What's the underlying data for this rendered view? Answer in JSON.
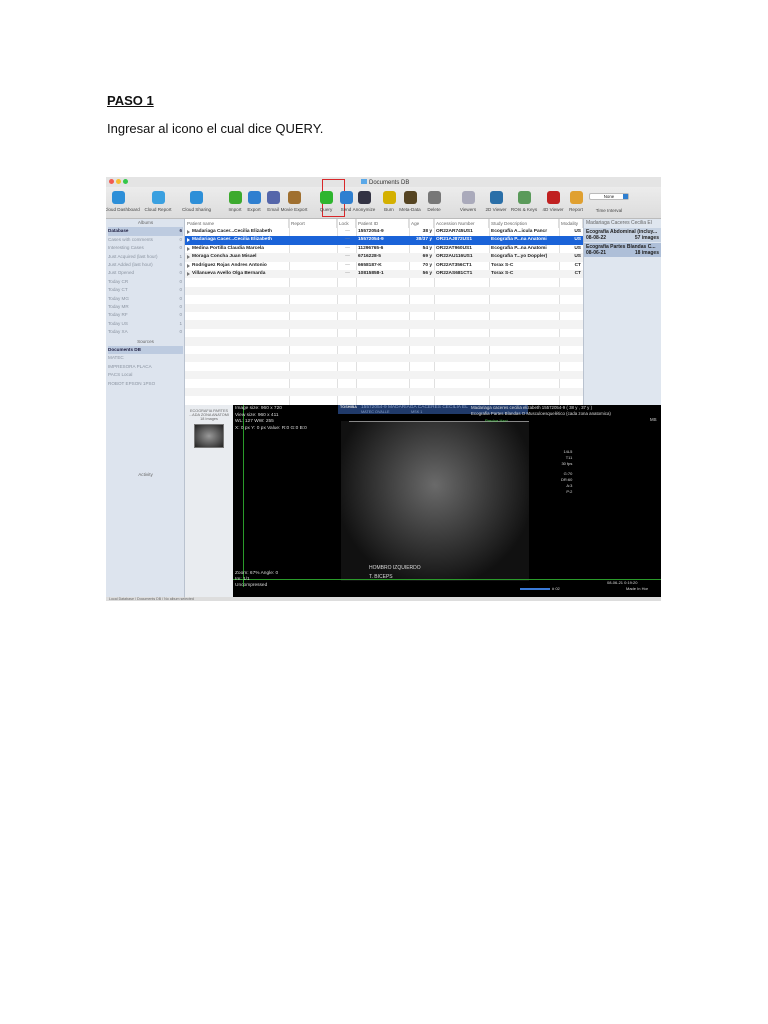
{
  "document": {
    "heading": "PASO 1",
    "instruction": "Ingresar al icono el cual dice QUERY."
  },
  "window": {
    "title": "Documents DB"
  },
  "toolbar": [
    {
      "label": "Cloud Dashboard",
      "color": "#2d8fd8"
    },
    {
      "label": "Cloud Report",
      "color": "#3aa0e0"
    },
    {
      "label": "Cloud Sharing",
      "color": "#2d8fd8"
    },
    {
      "label": "Import",
      "color": "#3caa2e"
    },
    {
      "label": "Export",
      "color": "#2f7fd0"
    },
    {
      "label": "Email",
      "color": "#5566aa"
    },
    {
      "label": "Movie Export",
      "color": "#a07030"
    },
    {
      "label": "Query",
      "color": "#2eb52e"
    },
    {
      "label": "Send",
      "color": "#2f7fd0"
    },
    {
      "label": "Anonymize",
      "color": "#334"
    },
    {
      "label": "Burn",
      "color": "#d4b000"
    },
    {
      "label": "Meta-Data",
      "color": "#554422"
    },
    {
      "label": "Delete",
      "color": "#777"
    },
    {
      "label": "Viewers",
      "color": "#aab"
    },
    {
      "label": "2D Viewer",
      "color": "#2a6fa8"
    },
    {
      "label": "ROIs & Keys",
      "color": "#5a9a5a"
    },
    {
      "label": "4D Viewer",
      "color": "#c02020"
    },
    {
      "label": "Report",
      "color": "#e0a030"
    }
  ],
  "time_interval": {
    "value": "None",
    "label": "Time Interval"
  },
  "sidebar": {
    "albums_header": "Albums",
    "albums": [
      {
        "label": "Database",
        "count": "6"
      },
      {
        "label": "Cases with comments",
        "count": "0"
      },
      {
        "label": "Interesting Cases",
        "count": "0"
      },
      {
        "label": "Just Acquired (last hour)",
        "count": "1"
      },
      {
        "label": "Just Added (last hour)",
        "count": "6"
      },
      {
        "label": "Just Opened",
        "count": "0"
      },
      {
        "label": "Today CR",
        "count": "0"
      },
      {
        "label": "Today CT",
        "count": "0"
      },
      {
        "label": "Today MG",
        "count": "0"
      },
      {
        "label": "Today MR",
        "count": "0"
      },
      {
        "label": "Today RF",
        "count": "0"
      },
      {
        "label": "Today US",
        "count": "1"
      },
      {
        "label": "Today XA",
        "count": "0"
      }
    ],
    "sources_header": "Sources",
    "sources": [
      "Documents DB",
      "MATEC",
      "IMPRESORA PLACA",
      "PACS Local",
      "ROBOT EPSON 1PSO"
    ],
    "activity": "Activity"
  },
  "table": {
    "columns": [
      "Patient name",
      "Report",
      "Lock",
      "Patient ID",
      "Age",
      "Accession Number",
      "Study Description",
      "Modality"
    ],
    "rows": [
      [
        "Madariaga Cacer...Cecilia Elizabeth",
        "",
        "—",
        "15572054-9",
        "38 y",
        "OR22AR745US1",
        "Ecografía A...icula Pancr",
        "US"
      ],
      [
        "Madariaga Cacer...Cecilia Elizabeth",
        "",
        "—",
        "15572054-9",
        "38/37 y",
        "OR21AJ872US1",
        "Ecografía P...na Anatomi",
        "US"
      ],
      [
        "Medina Portilla Claudia Marcela",
        "",
        "—",
        "11296765-6",
        "54 y",
        "OR22AT960US1",
        "Ecografía P...na Anatomi",
        "US"
      ],
      [
        "Moraga Concha Juan Misael",
        "",
        "—",
        "6716228-5",
        "69 y",
        "OR22AU116US1",
        "Ecografía T...yo Doppler)",
        "US"
      ],
      [
        "Rodriguez Rojas Andres Antonio",
        "",
        "—",
        "6658187-K",
        "70 y",
        "OR22AT356CT1",
        "Torax S-C",
        "CT"
      ],
      [
        "Villanueva Avello Olga Bernarda",
        "",
        "—",
        "10815858-1",
        "56 y",
        "OR22AS681CT1",
        "Torax S-C",
        "CT"
      ]
    ]
  },
  "right_panel": {
    "header": "Madariaga Caceres Cecilia El",
    "studies": [
      {
        "name": "Ecografía Abdominal (incluy...",
        "date": "08-08-22",
        "images": "57 images"
      },
      {
        "name": "Ecografía Partes Blandas C...",
        "date": "08-06-21",
        "images": "18 images"
      }
    ]
  },
  "thumbnail": {
    "title": "ECOGRAFIA PARTES ...ADA ZONA ANATOMI",
    "count": "18 Images"
  },
  "viewer": {
    "info": [
      "Image size: 960 x 720",
      "View size: 960 x 411",
      "WL: 127 WW: 255",
      "X: 0 px Y: 0 px Value: R:0 G:0 B:0"
    ],
    "bottom_left": [
      "Zoom: 67% Angle: 0",
      "Im: 1/1",
      "Uncompressed"
    ],
    "header_patient": "15572054-9 MADARIAGA CACERES CECILIA EL",
    "header_brand": "TOSHIBA",
    "header_site": "MATEC OVALLE",
    "header_ref": "MSK 1",
    "top_right_1": "Madariaga caceres cecilia elizabeth 15572054-9 ( 38 y , 37 y )",
    "top_right_2": "Ecografia Partes Blandas O Musculoesquelético (cada zona anatomica)",
    "top_right_3": "MS",
    "probe": "Precise  Har+",
    "params": [
      "14L5",
      "T11",
      "30 fps",
      "G:70",
      "DR:60",
      "A:3",
      "P:2"
    ],
    "annotations": [
      "HOMBRO IZQUIERDO",
      "T. BICEPS"
    ],
    "datetime": "08-06-21 0:19:20",
    "made_in": "Made In Hor",
    "frame": "# 02"
  },
  "status_bar": "Local Database / Documents DB / No album selected"
}
